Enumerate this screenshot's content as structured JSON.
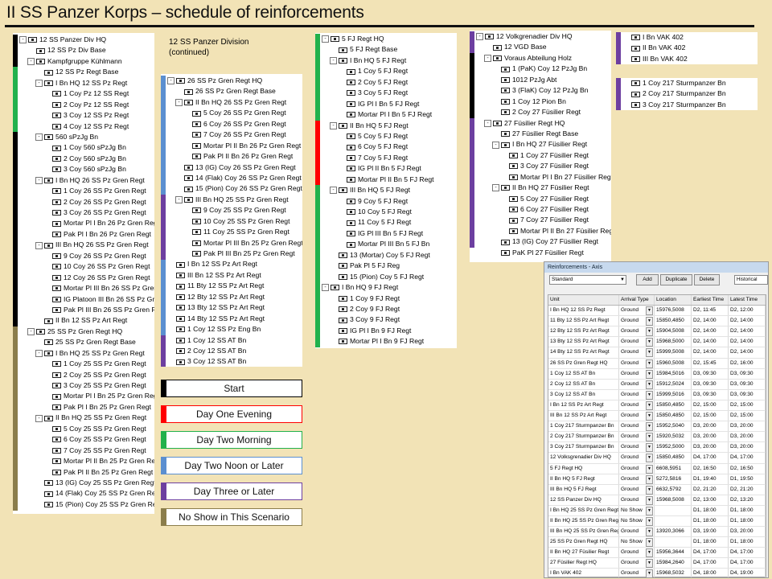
{
  "title": "II SS Panzer Korps – schedule of reinforcements",
  "colors": {
    "start": "#000000",
    "day_one_evening": "#ff0000",
    "day_two_morning": "#22b14c",
    "day_two_noon": "#5b8fd0",
    "day_three": "#6d3fa0",
    "no_show": "#8b7d4b"
  },
  "col1": {
    "bars": [
      {
        "color_key": "start",
        "from": 0,
        "to": 3
      },
      {
        "color_key": "day_two_morning",
        "from": 3,
        "to": 9
      },
      {
        "color_key": "start",
        "from": 9,
        "to": 27
      },
      {
        "color_key": "no_show",
        "from": 27,
        "to": 44
      }
    ],
    "rows": [
      {
        "level": 0,
        "toggle": "-",
        "label": "12 SS Panzer Div HQ"
      },
      {
        "level": 1,
        "toggle": "",
        "label": "12 SS Pz Div Base"
      },
      {
        "level": 1,
        "toggle": "-",
        "label": "Kampfgruppe Kühlmann"
      },
      {
        "level": 2,
        "toggle": "",
        "label": "12 SS Pz Regt Base"
      },
      {
        "level": 2,
        "toggle": "-",
        "label": "I Bn HQ 12 SS Pz Regt"
      },
      {
        "level": 3,
        "toggle": "",
        "label": "1 Coy Pz 12 SS Regt"
      },
      {
        "level": 3,
        "toggle": "",
        "label": "2 Coy Pz 12 SS Regt"
      },
      {
        "level": 3,
        "toggle": "",
        "label": "3 Coy 12 SS Pz Regt"
      },
      {
        "level": 3,
        "toggle": "",
        "label": "4 Coy 12 SS Pz Regt"
      },
      {
        "level": 2,
        "toggle": "-",
        "label": "560 sPzJg Bn"
      },
      {
        "level": 3,
        "toggle": "",
        "label": "1 Coy 560 sPzJg Bn"
      },
      {
        "level": 3,
        "toggle": "",
        "label": "2 Coy 560 sPzJg Bn"
      },
      {
        "level": 3,
        "toggle": "",
        "label": "3 Coy 560 sPzJg Bn"
      },
      {
        "level": 2,
        "toggle": "-",
        "label": "I Bn HQ 26 SS Pz Gren Regt"
      },
      {
        "level": 3,
        "toggle": "",
        "label": "1 Coy 26 SS Pz Gren Regt"
      },
      {
        "level": 3,
        "toggle": "",
        "label": "2 Coy 26 SS Pz Gren Regt"
      },
      {
        "level": 3,
        "toggle": "",
        "label": "3 Coy 26 SS Pz Gren Regt"
      },
      {
        "level": 3,
        "toggle": "",
        "label": "Mortar Pl I Bn 26 Pz Gren Regt"
      },
      {
        "level": 3,
        "toggle": "",
        "label": "Pak Pl I Bn 26 Pz Gren Regt"
      },
      {
        "level": 2,
        "toggle": "-",
        "label": "III Bn HQ 26 SS Pz Gren Regt"
      },
      {
        "level": 3,
        "toggle": "",
        "label": "9 Coy 26 SS Pz Gren Regt"
      },
      {
        "level": 3,
        "toggle": "",
        "label": "10 Coy 26 SS Pz Gren Regt"
      },
      {
        "level": 3,
        "toggle": "",
        "label": "12 Coy 26 SS Pz Gren Regt"
      },
      {
        "level": 3,
        "toggle": "",
        "label": "Mortar Pl III Bn 26 SS Pz Gren Regt"
      },
      {
        "level": 3,
        "toggle": "",
        "label": "IG Platoon III Bn 26 SS Pz Gren Regt"
      },
      {
        "level": 3,
        "toggle": "",
        "label": "Pak Pl III Bn 26 SS Pz Gren Regt"
      },
      {
        "level": 2,
        "toggle": "",
        "label": "II Bn 12 SS Pz Art Regt"
      },
      {
        "level": 1,
        "toggle": "-",
        "label": "25 SS Pz Gren Regt HQ"
      },
      {
        "level": 2,
        "toggle": "",
        "label": "25 SS Pz Gren Regt Base"
      },
      {
        "level": 2,
        "toggle": "-",
        "label": "I Bn HQ 25 SS Pz Gren Regt"
      },
      {
        "level": 3,
        "toggle": "",
        "label": "1 Coy 25 SS Pz Gren Regt"
      },
      {
        "level": 3,
        "toggle": "",
        "label": "2 Coy 25 SS Pz Gren Regt"
      },
      {
        "level": 3,
        "toggle": "",
        "label": "3 Coy 25 SS Pz Gren Regt"
      },
      {
        "level": 3,
        "toggle": "",
        "label": "Mortar Pl I Bn 25 Pz Gren Regt"
      },
      {
        "level": 3,
        "toggle": "",
        "label": "Pak Pl I Bn 25 Pz Gren Regt"
      },
      {
        "level": 2,
        "toggle": "-",
        "label": "II Bn HQ 25 SS Pz Gren Regt"
      },
      {
        "level": 3,
        "toggle": "",
        "label": "5 Coy 25 SS Pz Gren Regt"
      },
      {
        "level": 3,
        "toggle": "",
        "label": "6 Coy 25 SS Pz Gren Regt"
      },
      {
        "level": 3,
        "toggle": "",
        "label": "7 Coy 25 SS Pz Gren Regt"
      },
      {
        "level": 3,
        "toggle": "",
        "label": "Mortar Pl II Bn 25 Pz Gren Regt"
      },
      {
        "level": 3,
        "toggle": "",
        "label": "Pak Pl II Bn 25 Pz Gren Regt"
      },
      {
        "level": 2,
        "toggle": "",
        "label": "13 (IG) Coy 25 SS Pz Gren Regt"
      },
      {
        "level": 2,
        "toggle": "",
        "label": "14 (Flak) Coy 25 SS Pz Gren Regt"
      },
      {
        "level": 2,
        "toggle": "",
        "label": "15 (Pion) Coy 25 SS Pz Gren Regt"
      }
    ]
  },
  "col2": {
    "heading_line1": "12 SS Panzer Division",
    "heading_line2": "(continued)",
    "bars": [
      {
        "color_key": "day_two_noon",
        "from": 0,
        "to": 11
      },
      {
        "color_key": "day_three",
        "from": 11,
        "to": 17
      },
      {
        "color_key": "day_two_noon",
        "from": 17,
        "to": 24
      },
      {
        "color_key": "day_three",
        "from": 24,
        "to": 27
      }
    ],
    "rows": [
      {
        "level": 0,
        "toggle": "-",
        "label": "26 SS Pz Gren Regt HQ"
      },
      {
        "level": 1,
        "toggle": "",
        "label": "26 SS Pz Gren Regt Base"
      },
      {
        "level": 1,
        "toggle": "-",
        "label": "II Bn HQ 26 SS Pz Gren Regt"
      },
      {
        "level": 2,
        "toggle": "",
        "label": "5 Coy 26 SS Pz Gren Regt"
      },
      {
        "level": 2,
        "toggle": "",
        "label": "6 Coy 26 SS Pz Gren Regt"
      },
      {
        "level": 2,
        "toggle": "",
        "label": "7 Coy 26 SS Pz Gren Regt"
      },
      {
        "level": 2,
        "toggle": "",
        "label": "Mortar Pl II Bn 26 Pz Gren Regt"
      },
      {
        "level": 2,
        "toggle": "",
        "label": "Pak Pl II Bn 26 Pz Gren Regt"
      },
      {
        "level": 1,
        "toggle": "",
        "label": "13 (IG) Coy 26 SS Pz Gren Regt"
      },
      {
        "level": 1,
        "toggle": "",
        "label": "14 (Flak) Coy 26 SS Pz Gren Regt"
      },
      {
        "level": 1,
        "toggle": "",
        "label": "15 (Pion) Coy 26 SS Pz Gren Regt"
      },
      {
        "level": 1,
        "toggle": "-",
        "label": "III Bn HQ 25 SS Pz Gren Regt"
      },
      {
        "level": 2,
        "toggle": "",
        "label": "9 Coy 25 SS Pz Gren Regt"
      },
      {
        "level": 2,
        "toggle": "",
        "label": "10 Coy 25 SS Pz Gren Regt"
      },
      {
        "level": 2,
        "toggle": "",
        "label": "11 Coy 25 SS Pz Gren Regt"
      },
      {
        "level": 2,
        "toggle": "",
        "label": "Mortar Pl III Bn 25 Pz Gren Regt"
      },
      {
        "level": 2,
        "toggle": "",
        "label": "Pak Pl III Bn 25 Pz Gren Regt"
      },
      {
        "level": 0,
        "toggle": "",
        "label": "I Bn 12 SS Pz Art Regt"
      },
      {
        "level": 0,
        "toggle": "",
        "label": "III Bn 12 SS Pz Art Regt"
      },
      {
        "level": 0,
        "toggle": "",
        "label": "11 Bty 12 SS Pz Art Regt"
      },
      {
        "level": 0,
        "toggle": "",
        "label": "12 Bty 12 SS Pz Art Regt"
      },
      {
        "level": 0,
        "toggle": "",
        "label": "13 Bty 12 SS Pz Art Regt"
      },
      {
        "level": 0,
        "toggle": "",
        "label": "14 Bty 12 SS Pz Art Regt"
      },
      {
        "level": 0,
        "toggle": "",
        "label": "1 Coy 12 SS Pz Eng Bn"
      },
      {
        "level": 0,
        "toggle": "",
        "label": "1 Coy 12 SS AT Bn"
      },
      {
        "level": 0,
        "toggle": "",
        "label": "2 Coy 12 SS AT Bn"
      },
      {
        "level": 0,
        "toggle": "",
        "label": "3 Coy 12 SS AT Bn"
      }
    ]
  },
  "legend": [
    {
      "label": "Start",
      "color_key": "start"
    },
    {
      "label": "Day One Evening",
      "color_key": "day_one_evening"
    },
    {
      "label": "Day Two Morning",
      "color_key": "day_two_morning"
    },
    {
      "label": "Day Two Noon or Later",
      "color_key": "day_two_noon"
    },
    {
      "label": "Day Three or Later",
      "color_key": "day_three"
    },
    {
      "label": "No Show in This Scenario",
      "color_key": "no_show"
    }
  ],
  "col3": {
    "bars": [
      {
        "color_key": "day_two_morning",
        "from": 0,
        "to": 8
      },
      {
        "color_key": "day_one_evening",
        "from": 8,
        "to": 14
      },
      {
        "color_key": "day_two_morning",
        "from": 14,
        "to": 29
      }
    ],
    "rows": [
      {
        "level": 0,
        "toggle": "-",
        "label": "5 FJ Regt HQ"
      },
      {
        "level": 1,
        "toggle": "",
        "label": "5 FJ Regt Base"
      },
      {
        "level": 1,
        "toggle": "-",
        "label": "I Bn HQ 5 FJ Regt"
      },
      {
        "level": 2,
        "toggle": "",
        "label": "1 Coy 5 FJ Regt"
      },
      {
        "level": 2,
        "toggle": "",
        "label": "2 Coy 5 FJ Regt"
      },
      {
        "level": 2,
        "toggle": "",
        "label": "3 Coy 5 FJ Regt"
      },
      {
        "level": 2,
        "toggle": "",
        "label": "IG Pl I Bn 5 FJ Regt"
      },
      {
        "level": 2,
        "toggle": "",
        "label": "Mortar Pl I Bn 5 FJ Regt"
      },
      {
        "level": 1,
        "toggle": "-",
        "label": "II Bn HQ 5 FJ Regt"
      },
      {
        "level": 2,
        "toggle": "",
        "label": "5 Coy 5 FJ Regt"
      },
      {
        "level": 2,
        "toggle": "",
        "label": "6 Coy 5 FJ Regt"
      },
      {
        "level": 2,
        "toggle": "",
        "label": "7 Coy 5 FJ Regt"
      },
      {
        "level": 2,
        "toggle": "",
        "label": "IG Pl II Bn 5 FJ Regt"
      },
      {
        "level": 2,
        "toggle": "",
        "label": "Mortar Pl II Bn 5 FJ Regt"
      },
      {
        "level": 1,
        "toggle": "-",
        "label": "III Bn HQ 5 FJ Regt"
      },
      {
        "level": 2,
        "toggle": "",
        "label": "9 Coy 5 FJ Regt"
      },
      {
        "level": 2,
        "toggle": "",
        "label": "10 Coy 5 FJ Regt"
      },
      {
        "level": 2,
        "toggle": "",
        "label": "11 Coy 5 FJ Regt"
      },
      {
        "level": 2,
        "toggle": "",
        "label": "IG Pl III Bn 5 FJ Regt"
      },
      {
        "level": 2,
        "toggle": "",
        "label": "Mortar Pl III Bn 5 FJ Bn"
      },
      {
        "level": 1,
        "toggle": "",
        "label": "13 (Mortar) Coy 5 FJ Regt"
      },
      {
        "level": 1,
        "toggle": "",
        "label": "Pak Pl 5 FJ Reg"
      },
      {
        "level": 1,
        "toggle": "",
        "label": "15 (Pion) Coy 5 FJ Regt"
      },
      {
        "level": 0,
        "toggle": "-",
        "label": "I Bn HQ 9 FJ Regt"
      },
      {
        "level": 1,
        "toggle": "",
        "label": "1 Coy 9 FJ Regt"
      },
      {
        "level": 1,
        "toggle": "",
        "label": "2 Coy 9 FJ Regt"
      },
      {
        "level": 1,
        "toggle": "",
        "label": "3 Coy 9 FJ Regt"
      },
      {
        "level": 1,
        "toggle": "",
        "label": "IG Pl I Bn 9 FJ Regt"
      },
      {
        "level": 1,
        "toggle": "",
        "label": "Mortar Pl I Bn 9 FJ Regt"
      }
    ]
  },
  "col4": {
    "bars": [
      {
        "color_key": "day_three",
        "from": 0,
        "to": 2
      },
      {
        "color_key": "start",
        "from": 2,
        "to": 8
      },
      {
        "color_key": "day_three",
        "from": 8,
        "to": 20
      }
    ],
    "rows": [
      {
        "level": 0,
        "toggle": "-",
        "label": "12 Volkgrenadier Div HQ"
      },
      {
        "level": 1,
        "toggle": "",
        "label": "12 VGD Base"
      },
      {
        "level": 1,
        "toggle": "-",
        "label": "Voraus Abteilung Holz"
      },
      {
        "level": 2,
        "toggle": "",
        "label": "1 (PaK) Coy 12 PzJg Bn"
      },
      {
        "level": 2,
        "toggle": "",
        "label": "1012 PzJg Abt"
      },
      {
        "level": 2,
        "toggle": "",
        "label": "3 (FlaK) Coy 12 PzJg Bn"
      },
      {
        "level": 2,
        "toggle": "",
        "label": "1 Coy 12 Pion Bn"
      },
      {
        "level": 2,
        "toggle": "",
        "label": "2 Coy 27 Füsilier Regt"
      },
      {
        "level": 1,
        "toggle": "-",
        "label": "27 Füsilier Regt HQ"
      },
      {
        "level": 2,
        "toggle": "",
        "label": "27 Füsilier Regt Base"
      },
      {
        "level": 2,
        "toggle": "-",
        "label": "I Bn HQ 27 Füsilier Regt"
      },
      {
        "level": 3,
        "toggle": "",
        "label": "1 Coy 27 Füsilier Regt"
      },
      {
        "level": 3,
        "toggle": "",
        "label": "3 Coy 27 Füsilier Regt"
      },
      {
        "level": 3,
        "toggle": "",
        "label": "Mortar Pl I Bn 27 Füsilier Regt"
      },
      {
        "level": 2,
        "toggle": "-",
        "label": "II Bn HQ 27 Füsilier Regt"
      },
      {
        "level": 3,
        "toggle": "",
        "label": "5 Coy 27 Füsilier Regt"
      },
      {
        "level": 3,
        "toggle": "",
        "label": "6 Coy 27 Füsilier Regt"
      },
      {
        "level": 3,
        "toggle": "",
        "label": "7 Coy 27 Füsilier Regt"
      },
      {
        "level": 3,
        "toggle": "",
        "label": "Mortar Pl II Bn 27 Füsilier Regt"
      },
      {
        "level": 2,
        "toggle": "",
        "label": "13 (IG) Coy 27 Füsilier Regt"
      },
      {
        "level": 2,
        "toggle": "",
        "label": "PaK Pl 27 Füsilier Regt"
      }
    ]
  },
  "col5a": {
    "bars": [
      {
        "color_key": "day_three",
        "from": 0,
        "to": 3
      }
    ],
    "rows": [
      {
        "level": 0,
        "toggle": "",
        "label": "I Bn VAK 402"
      },
      {
        "level": 0,
        "toggle": "",
        "label": "II Bn VAK 402"
      },
      {
        "level": 0,
        "toggle": "",
        "label": "III Bn VAK 402"
      }
    ]
  },
  "col5b": {
    "bars": [
      {
        "color_key": "day_three",
        "from": 0,
        "to": 3
      }
    ],
    "rows": [
      {
        "level": 0,
        "toggle": "",
        "label": "1 Coy 217 Sturmpanzer Bn"
      },
      {
        "level": 0,
        "toggle": "",
        "label": "2 Coy 217 Sturmpanzer Bn"
      },
      {
        "level": 0,
        "toggle": "",
        "label": "3 Coy 217 Sturmpanzer Bn"
      }
    ]
  },
  "reinforcements": {
    "window_title": "Reinforcements - Axis",
    "side_select": "Standard",
    "buttons": {
      "add": "Add",
      "duplicate": "Duplicate",
      "delete": "Delete"
    },
    "mode_select": "Historical",
    "columns": [
      "Unit",
      "Arrival Type",
      "Location",
      "Earliest Time",
      "Latest Time"
    ],
    "rows": [
      [
        "I Bn HQ 12 SS Pz Regt",
        "Ground",
        "15976,5008",
        "D2, 11:45",
        "D2, 12:00"
      ],
      [
        "11 Bty 12 SS Pz Art Regt",
        "Ground",
        "15850,4850",
        "D2, 14:00",
        "D2, 14:00"
      ],
      [
        "12 Bty 12 SS Pz Art Regt",
        "Ground",
        "15904,5008",
        "D2, 14:00",
        "D2, 14:00"
      ],
      [
        "13 Bty 12 SS Pz Art Regt",
        "Ground",
        "15968,5000",
        "D2, 14:00",
        "D2, 14:00"
      ],
      [
        "14 Bty 12 SS Pz Art Regt",
        "Ground",
        "15999,5008",
        "D2, 14:00",
        "D2, 14:00"
      ],
      [
        "26 SS Pz Gren Regt HQ",
        "Ground",
        "15960,5008",
        "D2, 15:45",
        "D2, 16:00"
      ],
      [
        "1 Coy 12 SS AT Bn",
        "Ground",
        "15984,5016",
        "D3, 09:30",
        "D3, 09:30"
      ],
      [
        "2 Coy 12 SS AT Bn",
        "Ground",
        "15912,5024",
        "D3, 09:30",
        "D3, 09:30"
      ],
      [
        "3 Coy 12 SS AT Bn",
        "Ground",
        "15999,5016",
        "D3, 09:30",
        "D3, 09:30"
      ],
      [
        "I Bn 12 SS Pz Art Regt",
        "Ground",
        "15850,4850",
        "D2, 15:00",
        "D2, 15:00"
      ],
      [
        "III Bn 12 SS Pz Art Regt",
        "Ground",
        "15850,4850",
        "D2, 15:00",
        "D2, 15:00"
      ],
      [
        "1 Coy 217 Sturmpanzer Bn",
        "Ground",
        "15952,5040",
        "D3, 20:00",
        "D3, 20:00"
      ],
      [
        "2 Coy 217 Sturmpanzer Bn",
        "Ground",
        "15920,5032",
        "D3, 20:00",
        "D3, 20:00"
      ],
      [
        "3 Coy 217 Sturmpanzer Bn",
        "Ground",
        "15952,5000",
        "D3, 20:00",
        "D3, 20:00"
      ],
      [
        "12 Volksgrenadier Div HQ",
        "Ground",
        "15850,4850",
        "D4, 17:00",
        "D4, 17:00"
      ],
      [
        "5 FJ Regt HQ",
        "Ground",
        "6608,5951",
        "D2, 16:50",
        "D2, 16:50"
      ],
      [
        "II Bn HQ 5 FJ Regt",
        "Ground",
        "5272,5816",
        "D1, 19:40",
        "D1, 19:50"
      ],
      [
        "III Bn HQ 5 FJ Regt",
        "Ground",
        "6632,5792",
        "D2, 21:20",
        "D2, 21:20"
      ],
      [
        "12 SS Panzer Div HQ",
        "Ground",
        "15968,5008",
        "D2, 13:00",
        "D2, 13:20"
      ],
      [
        "I Bn HQ 25 SS Pz Gren Regt",
        "No Show",
        "",
        "D1, 18:00",
        "D1, 18:00"
      ],
      [
        "II Bn HQ 25 SS Pz Gren Regt",
        "No Show",
        "",
        "D1, 18:00",
        "D1, 18:00"
      ],
      [
        "III Bn HQ 25 SS Pz Gren Regt",
        "Ground",
        "13920,3066",
        "D3, 19:00",
        "D3, 20:00"
      ],
      [
        "25 SS Pz Gren Regt HQ",
        "No Show",
        "",
        "D1, 18:00",
        "D1, 18:00"
      ],
      [
        "II Bn HQ 27 Füsilier Regt",
        "Ground",
        "15956,3644",
        "D4, 17:00",
        "D4, 17:00"
      ],
      [
        "27 Füsilier Regt HQ",
        "Ground",
        "15984,2640",
        "D4, 17:00",
        "D4, 17:00"
      ],
      [
        "I Bn VAK 402",
        "Ground",
        "15968,5032",
        "D4, 18:00",
        "D4, 19:00"
      ],
      [
        "II Bn VAK 402",
        "Ground",
        "15972,5028",
        "D4, 20:00",
        "D4, 21:00"
      ],
      [
        "III Bn VAK 402",
        "Ground",
        "15960,5012",
        "D4, 22:00",
        "D4, 23:00"
      ]
    ]
  }
}
